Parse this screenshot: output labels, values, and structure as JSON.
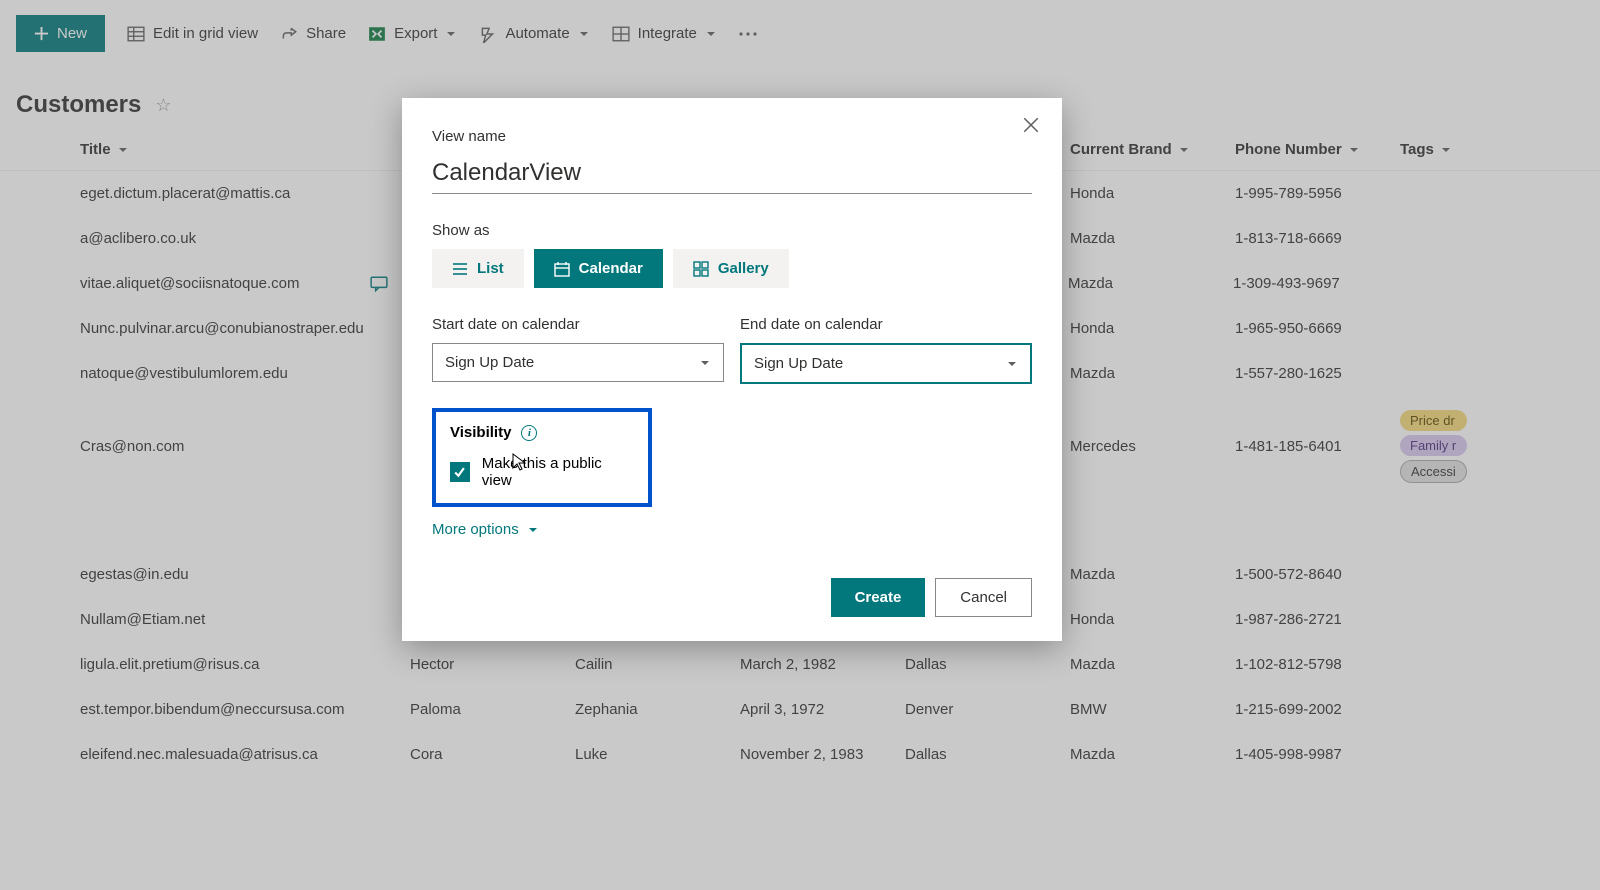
{
  "toolbar": {
    "new": "New",
    "edit_grid": "Edit in grid view",
    "share": "Share",
    "export": "Export",
    "automate": "Automate",
    "integrate": "Integrate"
  },
  "page": {
    "title": "Customers"
  },
  "columns": {
    "title": "Title",
    "current_brand": "Current Brand",
    "phone": "Phone Number",
    "tags": "Tags"
  },
  "rows": [
    {
      "title": "eget.dictum.placerat@mattis.ca",
      "brand": "Honda",
      "phone": "1-995-789-5956"
    },
    {
      "title": "a@aclibero.co.uk",
      "brand": "Mazda",
      "phone": "1-813-718-6669"
    },
    {
      "title": "vitae.aliquet@sociisnatoque.com",
      "brand": "Mazda",
      "phone": "1-309-493-9697",
      "has_comment": true
    },
    {
      "title": "Nunc.pulvinar.arcu@conubianostraper.edu",
      "brand": "Honda",
      "phone": "1-965-950-6669"
    },
    {
      "title": "natoque@vestibulumlorem.edu",
      "brand": "Mazda",
      "phone": "1-557-280-1625"
    },
    {
      "title": "Cras@non.com",
      "brand": "Mercedes",
      "phone": "1-481-185-6401",
      "tags": [
        "Price dr",
        "Family r",
        "Accessi"
      ]
    },
    {
      "title": "egestas@in.edu",
      "brand": "Mazda",
      "phone": "1-500-572-8640"
    },
    {
      "title": "Nullam@Etiam.net",
      "brand": "Honda",
      "phone": "1-987-286-2721"
    },
    {
      "title": "ligula.elit.pretium@risus.ca",
      "fn": "Hector",
      "ln": "Cailin",
      "dob": "March 2, 1982",
      "city": "Dallas",
      "brand": "Mazda",
      "phone": "1-102-812-5798"
    },
    {
      "title": "est.tempor.bibendum@neccursusa.com",
      "fn": "Paloma",
      "ln": "Zephania",
      "dob": "April 3, 1972",
      "city": "Denver",
      "brand": "BMW",
      "phone": "1-215-699-2002"
    },
    {
      "title": "eleifend.nec.malesuada@atrisus.ca",
      "fn": "Cora",
      "ln": "Luke",
      "dob": "November 2, 1983",
      "city": "Dallas",
      "brand": "Mazda",
      "phone": "1-405-998-9987"
    }
  ],
  "modal": {
    "view_name_label": "View name",
    "view_name_value": "CalendarView",
    "show_as_label": "Show as",
    "show_as": {
      "list": "List",
      "calendar": "Calendar",
      "gallery": "Gallery",
      "active": "calendar"
    },
    "start_date_label": "Start date on calendar",
    "start_date_value": "Sign Up Date",
    "end_date_label": "End date on calendar",
    "end_date_value": "Sign Up Date",
    "visibility_label": "Visibility",
    "visibility_checkbox_label": "Make this a public view",
    "visibility_checked": true,
    "more_options": "More options",
    "create": "Create",
    "cancel": "Cancel"
  }
}
